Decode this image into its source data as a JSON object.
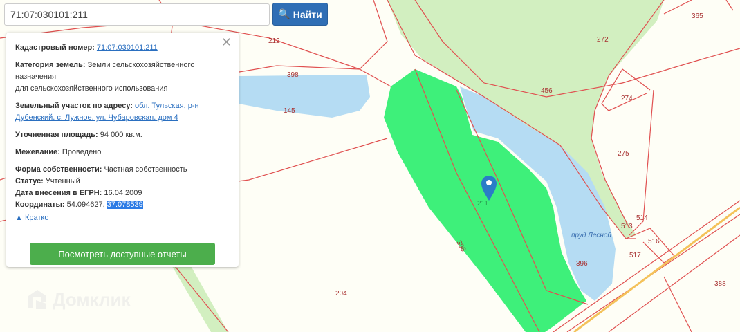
{
  "search": {
    "value": "71:07:030101:211",
    "button_label": "Найти",
    "icon": "search-icon"
  },
  "panel": {
    "cadastral_label": "Кадастровый номер:",
    "cadastral_value": "71:07:030101:211",
    "category_label": "Категория земель:",
    "category_value": "Земли сельскохозяйственного назначения",
    "category_use": "для сельскохозяйственного использования",
    "address_label": "Земельный участок по адресу:",
    "address_value": "обл. Тульская, р-н Дубенский, с. Лужное, ул. Чубаровская, дом 4",
    "area_label": "Уточненная площадь:",
    "area_value": "94 000 кв.м.",
    "survey_label": "Межевание:",
    "survey_value": "Проведено",
    "ownership_label": "Форма собственности:",
    "ownership_value": "Частная собственность",
    "status_label": "Статус:",
    "status_value": "Учтенный",
    "date_label": "Дата внесения в ЕГРН:",
    "date_value": "16.04.2009",
    "coords_label": "Координаты:",
    "lat": "54.094627,",
    "lon": "37.078539",
    "brief_label": "Кратко",
    "reports_button": "Посмотреть доступные отчеты"
  },
  "map": {
    "parcel_labels": [
      "212",
      "398",
      "145",
      "456",
      "272",
      "365",
      "274",
      "275",
      "211",
      "396",
      "396",
      "513",
      "514",
      "516",
      "517",
      "204",
      "388"
    ],
    "pond_label": "пруд Лесной",
    "selected_parcel_color": "#3ef07a",
    "water_color": "#b5dcf3",
    "forest_color": "#d2efc0",
    "boundary_color": "#e05050"
  },
  "watermark": "Домклик"
}
